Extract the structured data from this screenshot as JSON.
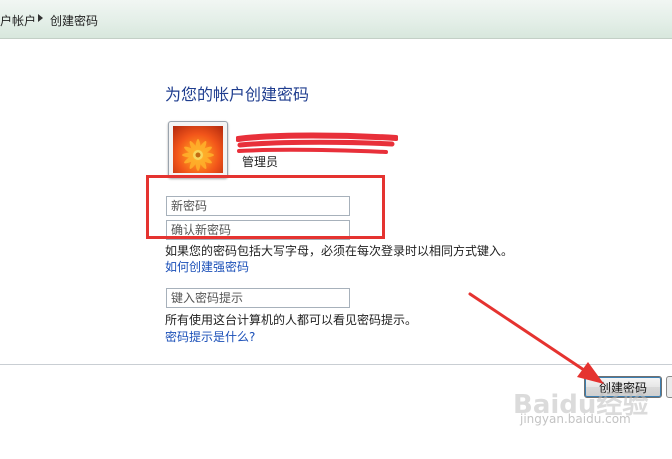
{
  "breadcrumb": {
    "item_1": "户帐户",
    "item_2": "创建密码"
  },
  "main": {
    "title": "为您的帐户创建密码",
    "account_role": "管理员",
    "new_password_placeholder": "新密码",
    "confirm_password_placeholder": "确认新密码",
    "case_note": "如果您的密码包括大写字母，必须在每次登录时以相同方式键入。",
    "strong_password_link": "如何创建强密码",
    "hint_placeholder": "键入密码提示",
    "hint_note": "所有使用这台计算机的人都可以看见密码提示。",
    "hint_link": "密码提示是什么?"
  },
  "footer": {
    "create_button": "创建密码"
  },
  "watermark": {
    "logo": "Baidu经验",
    "url": "jingyan.baidu.com"
  },
  "colors": {
    "annotation_red": "#e53330",
    "link_blue": "#1a4fb8",
    "title_blue": "#1f3d8f"
  }
}
